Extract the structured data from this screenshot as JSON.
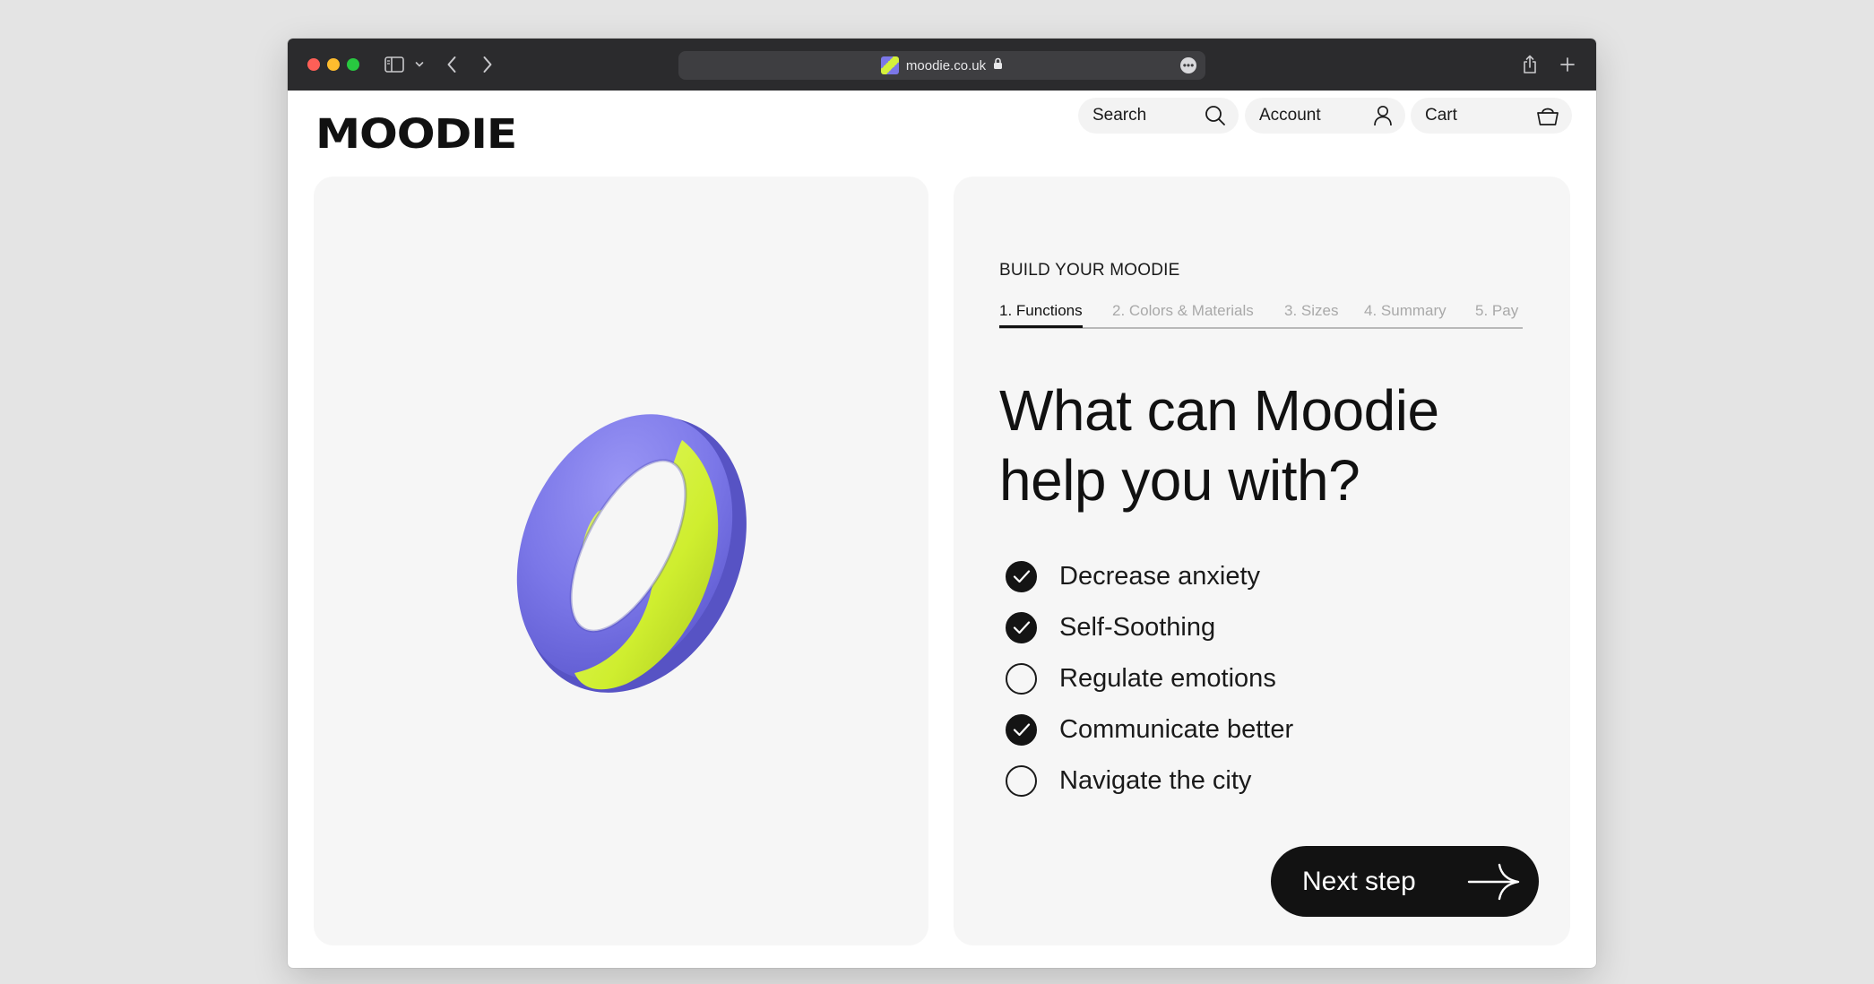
{
  "browser": {
    "url": "moodie.co.uk",
    "icons": {
      "sidebar": "sidebar-icon",
      "chevron": "chevron-down-icon",
      "back": "back-icon",
      "forward": "forward-icon",
      "lock": "lock-icon",
      "more": "more-icon",
      "share": "share-icon",
      "new_tab": "plus-icon"
    }
  },
  "header": {
    "logo": "MOODIE",
    "search_label": "Search",
    "account_label": "Account",
    "cart_label": "Cart"
  },
  "builder": {
    "eyebrow": "BUILD YOUR MOODIE",
    "steps": [
      {
        "label": "1.  Functions",
        "active": true
      },
      {
        "label": "2. Colors & Materials",
        "active": false
      },
      {
        "label": "3. Sizes",
        "active": false
      },
      {
        "label": "4. Summary",
        "active": false
      },
      {
        "label": "5. Pay",
        "active": false
      }
    ],
    "headline_line1": "What can Moodie",
    "headline_line2": "help you with?",
    "options": [
      {
        "label": "Decrease anxiety",
        "checked": true
      },
      {
        "label": "Self-Soothing",
        "checked": true
      },
      {
        "label": "Regulate emotions",
        "checked": false
      },
      {
        "label": "Communicate better",
        "checked": true
      },
      {
        "label": "Navigate the city",
        "checked": false
      }
    ],
    "next_label": "Next step"
  },
  "colors": {
    "ring_purple": "#7b77e8",
    "ring_green": "#d4f03b",
    "button_dark": "#121212"
  }
}
